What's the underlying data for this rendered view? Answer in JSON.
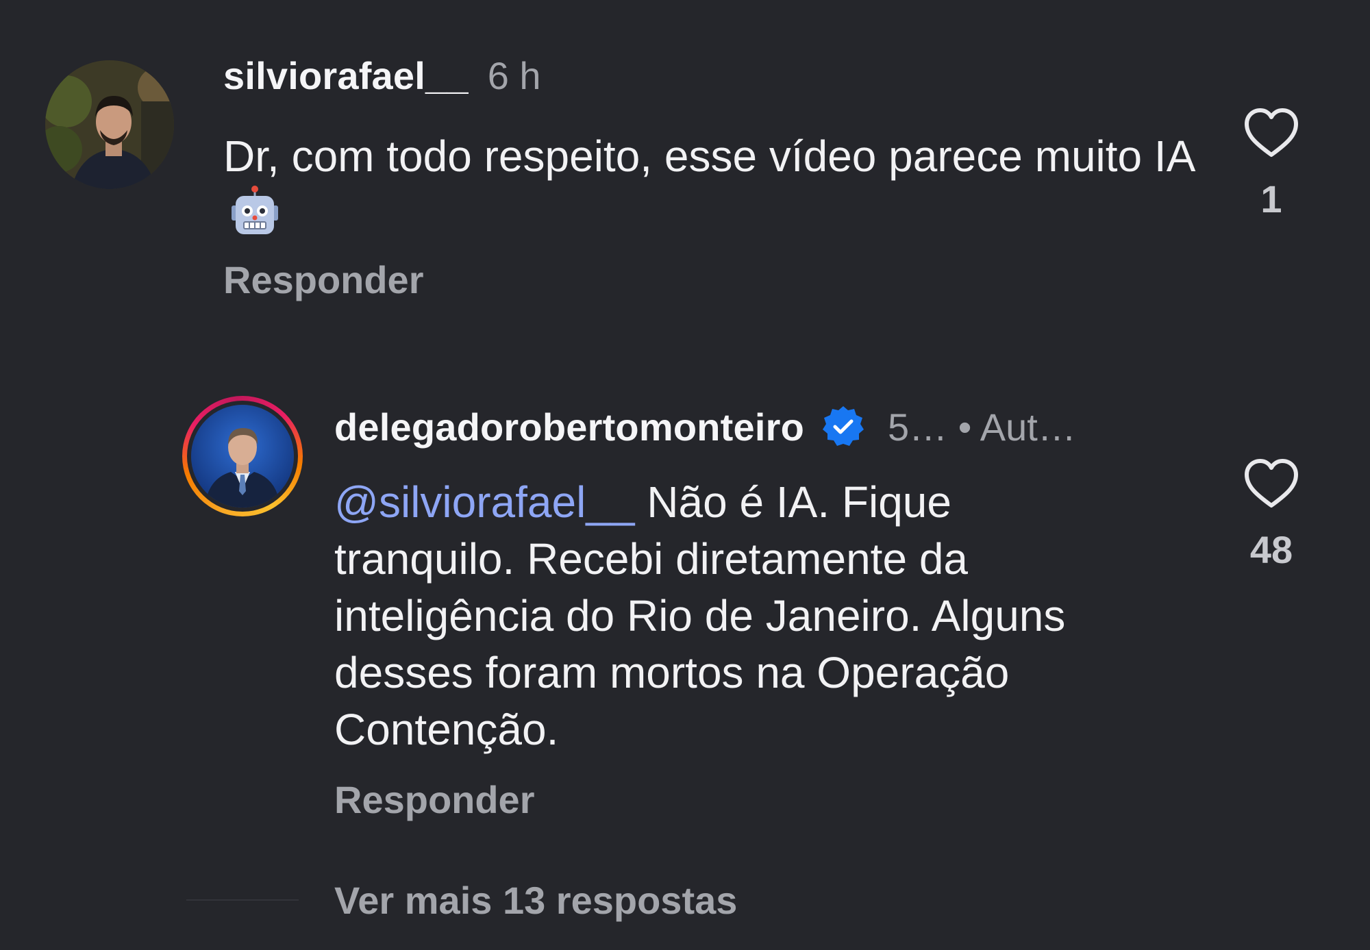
{
  "comments": [
    {
      "username": "silviorafael__",
      "timestamp": "6 h",
      "text": "Dr, com todo respeito, esse vídeo parece muito IA",
      "emoji": "robot-face",
      "reply_label": "Responder",
      "like_count": "1",
      "avatar": "profile-photo"
    },
    {
      "username": "delegadorobertomonteiro",
      "verified": true,
      "meta": "5… • Aut…",
      "mention": "@silviorafael__",
      "text": "Não é IA. Fique tranquilo. Recebi diretamente da inteligência do Rio de Janeiro. Alguns desses foram mortos na Operação Contenção.",
      "reply_label": "Responder",
      "like_count": "48",
      "avatar": "profile-photo-story-ring"
    }
  ],
  "view_more_replies": "Ver mais 13 respostas",
  "colors": {
    "background": "#25262b",
    "primary_text": "#f2f2f4",
    "secondary_text": "#a3a5ab",
    "mention": "#8ea6f5",
    "verified": "#1877f2"
  },
  "icons": {
    "like": "heart-outline-icon",
    "verified": "verified-badge-icon"
  }
}
